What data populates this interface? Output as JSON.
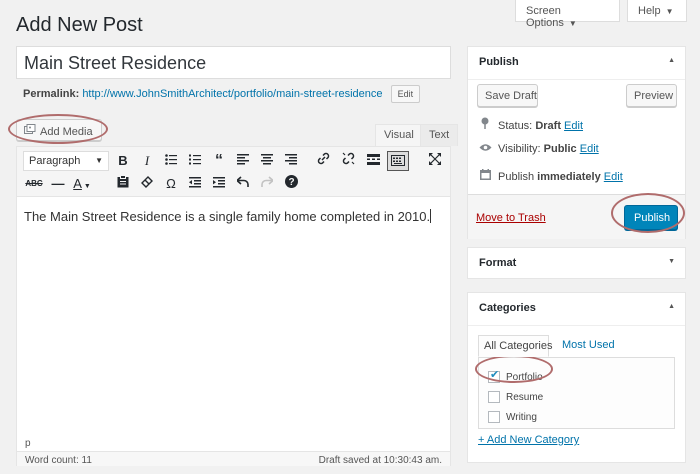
{
  "page": {
    "title": "Add New Post"
  },
  "screen_options": {
    "label": "Screen Options",
    "caret": "▼"
  },
  "help": {
    "label": "Help",
    "caret": "▼"
  },
  "post": {
    "title": "Main Street Residence",
    "permalink_label": "Permalink:",
    "permalink_url": "http://www.JohnSmithArchitect/portfolio/main-street-residence",
    "edit_label": "Edit"
  },
  "media": {
    "add_label": "Add Media"
  },
  "editor_tabs": {
    "visual": "Visual",
    "text": "Text"
  },
  "toolbar": {
    "paragraph": "Paragraph",
    "caret": "▼"
  },
  "content": {
    "text": "The Main Street Residence is a single family home completed in 2010."
  },
  "status_bar": {
    "path": "p",
    "word_count": "Word count: 11",
    "draft_saved": "Draft saved at 10:30:43 am."
  },
  "publish": {
    "heading": "Publish",
    "save_draft": "Save Draft",
    "preview": "Preview",
    "status_label": "Status:",
    "status_value": "Draft",
    "visibility_label": "Visibility:",
    "visibility_value": "Public",
    "schedule_label": "Publish",
    "schedule_value": "immediately",
    "edit": "Edit",
    "trash": "Move to Trash",
    "publish_button": "Publish"
  },
  "format": {
    "heading": "Format"
  },
  "categories": {
    "heading": "Categories",
    "tab_all": "All Categories",
    "tab_most_used": "Most Used",
    "items": [
      {
        "label": "Portfolio",
        "checked": true
      },
      {
        "label": "Resume",
        "checked": false
      },
      {
        "label": "Writing",
        "checked": false
      }
    ],
    "add_new": "+ Add New Category"
  },
  "colors": {
    "accent": "#0085ba",
    "link": "#0073aa",
    "annotation": "#b06c6c"
  }
}
